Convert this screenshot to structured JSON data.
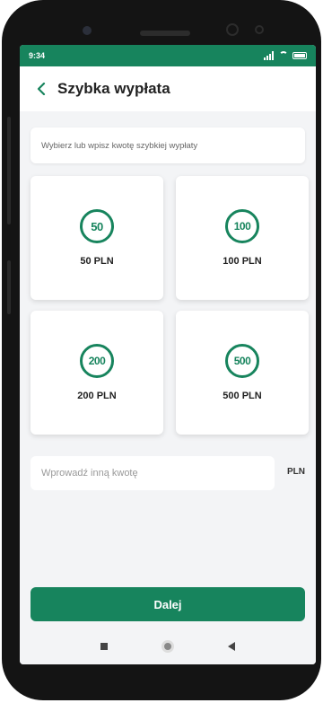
{
  "status": {
    "time": "9:34"
  },
  "header": {
    "title": "Szybka wypłata"
  },
  "instruction": "Wybierz lub wpisz kwotę szybkiej wypłaty",
  "amounts": [
    {
      "badge": "50",
      "label": "50 PLN"
    },
    {
      "badge": "100",
      "label": "100 PLN"
    },
    {
      "badge": "200",
      "label": "200 PLN"
    },
    {
      "badge": "500",
      "label": "500 PLN"
    }
  ],
  "custom_amount": {
    "placeholder": "Wprowadź inną kwotę",
    "currency": "PLN"
  },
  "next_label": "Dalej",
  "colors": {
    "accent": "#17845d",
    "background": "#f3f4f6"
  }
}
